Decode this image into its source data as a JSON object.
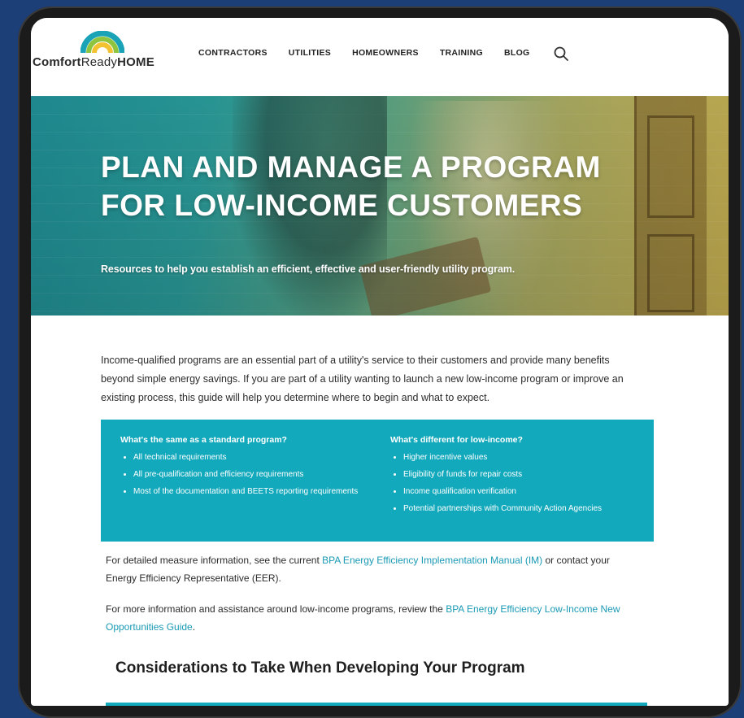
{
  "brand": {
    "logo_part1": "Comfort",
    "logo_part2": "Ready",
    "logo_part3": "HOME",
    "arc_colors": [
      "#f2c230",
      "#8fc43e",
      "#1aa3b7"
    ]
  },
  "nav": {
    "items": [
      "CONTRACTORS",
      "UTILITIES",
      "HOMEOWNERS",
      "TRAINING",
      "BLOG"
    ],
    "search_icon": "search-icon"
  },
  "hero": {
    "title": "PLAN AND MANAGE A PROGRAM FOR LOW-INCOME CUSTOMERS",
    "subtitle": "Resources to help you establish an efficient, effective and user-friendly utility program."
  },
  "intro": "Income-qualified programs are an essential part of a utility's service to their customers and provide many benefits beyond simple energy savings. If you are part of a utility wanting to launch a new low-income program or improve an existing process, this guide will help you determine where to begin and what to expect.",
  "callout": {
    "left_heading": "What's the same as a standard program?",
    "left_items": [
      "All technical requirements",
      "All pre-qualification and efficiency requirements",
      "Most of the documentation and BEETS reporting requirements"
    ],
    "right_heading": "What's different for low-income?",
    "right_items": [
      "Higher incentive values",
      "Eligibility of funds for repair costs",
      "Income qualification verification",
      "Potential partnerships with Community Action Agencies"
    ]
  },
  "para1": {
    "before": "For detailed measure information, see the current ",
    "link": "BPA Energy Efficiency Implementation Manual (IM)",
    "after": " or contact your Energy Efficiency Representative (EER)."
  },
  "para2": {
    "before": "For more information and assistance around low-income programs, review the ",
    "link": "BPA Energy Efficiency Low-Income New Opportunities Guide",
    "after": "."
  },
  "section_heading": "Considerations to Take When Developing Your Program",
  "colors": {
    "accent": "#13a9bc",
    "link": "#1a9ab5",
    "page_bg": "#1d3f78"
  }
}
